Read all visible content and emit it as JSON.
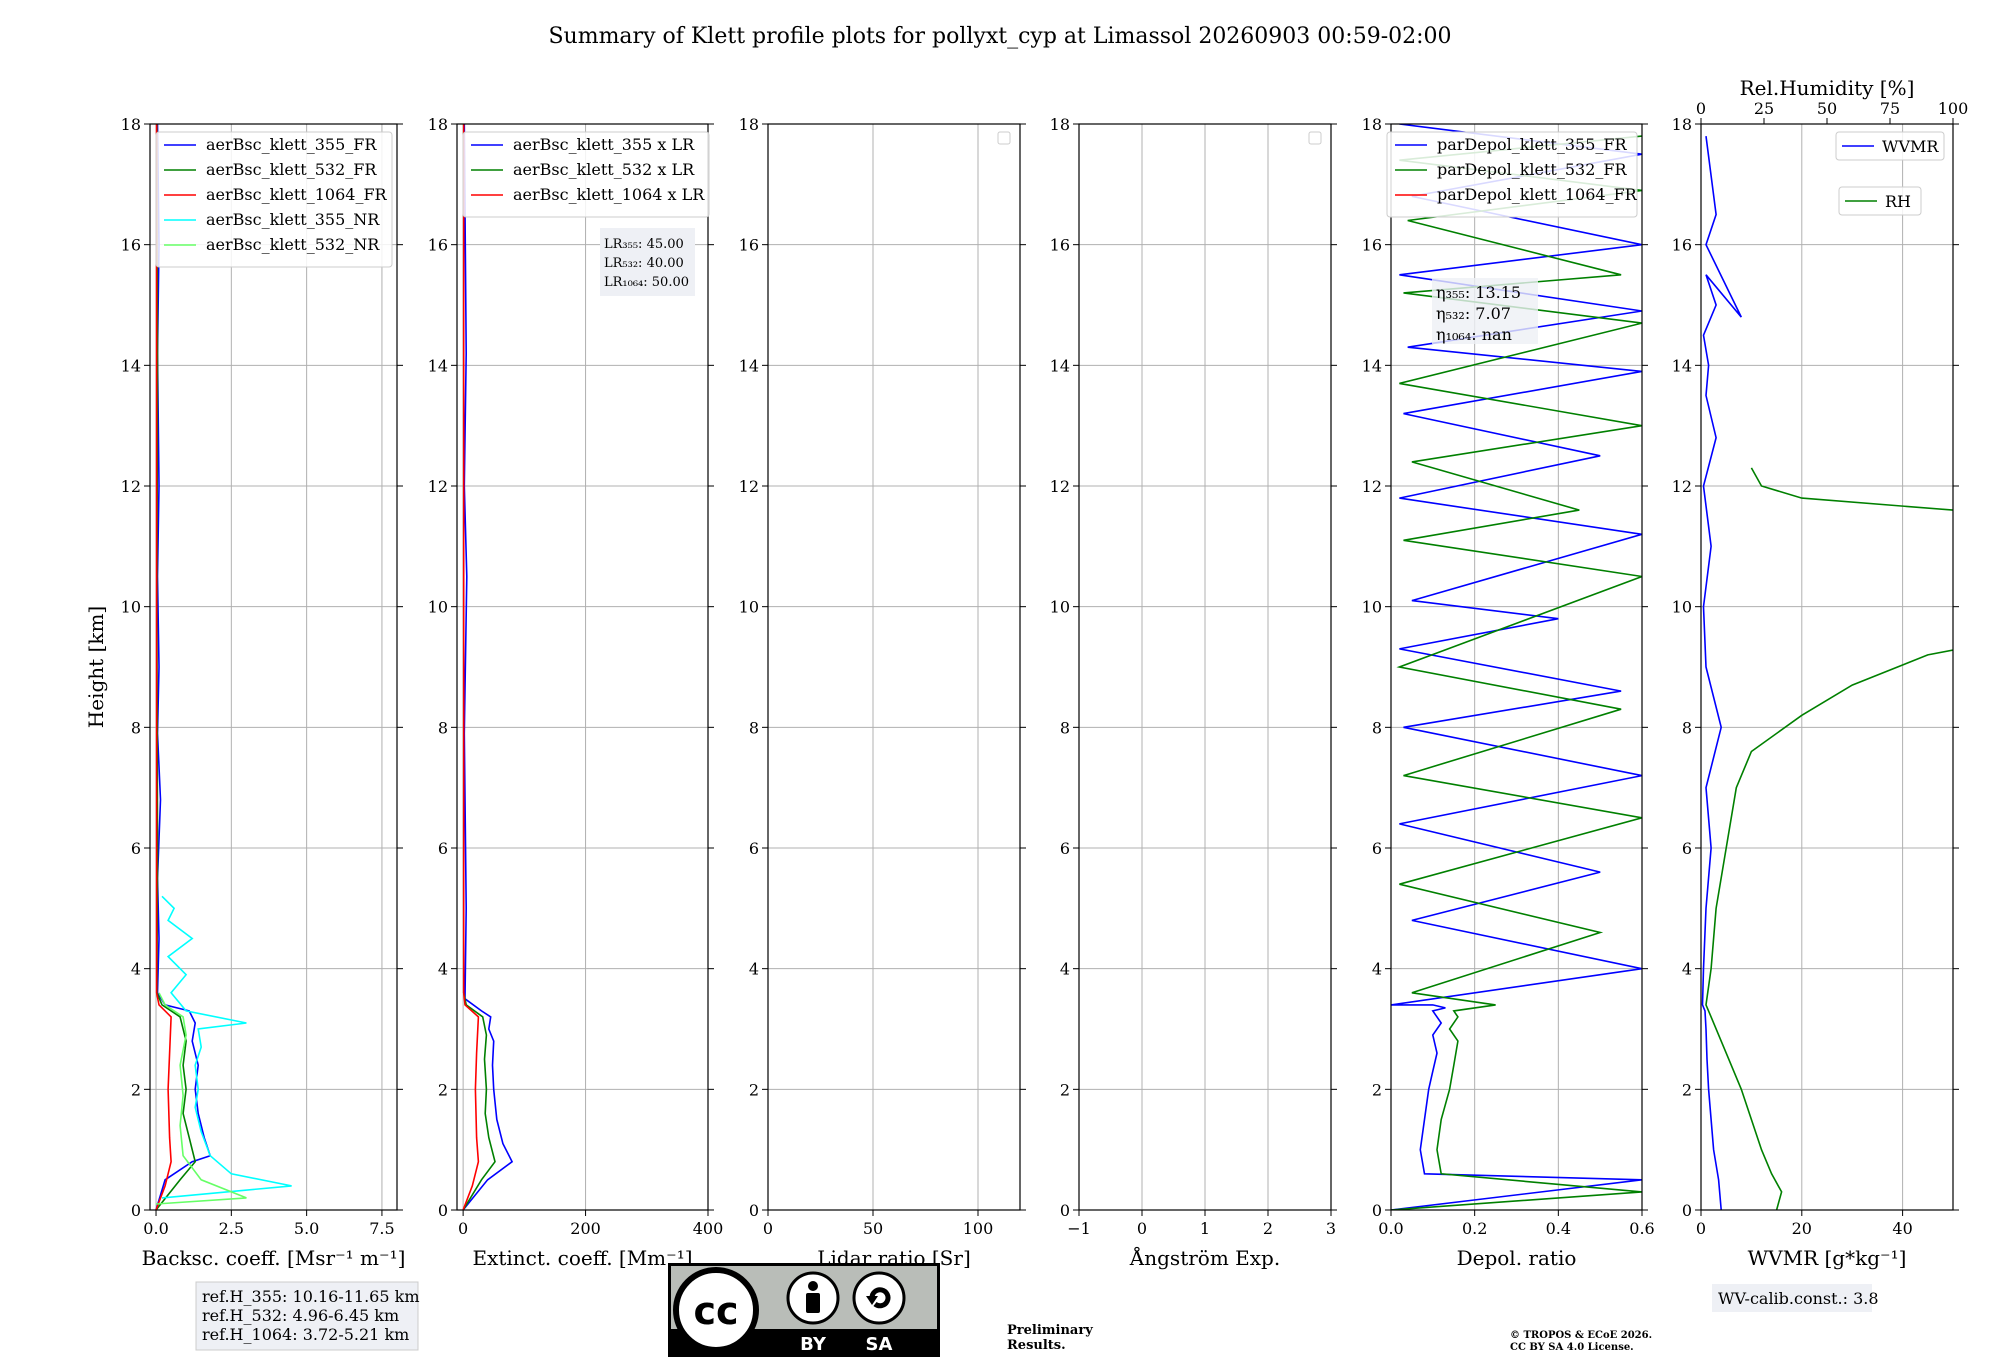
{
  "title": "Summary of Klett profile plots for pollyxt_cyp at Limassol 20260903 00:59-02:00",
  "chart_data": [
    {
      "type": "line",
      "id": "bsc",
      "xlabel": "Backsc. coeff. [Msr⁻¹ m⁻¹]",
      "ylabel": "Height [km]",
      "xlim": [
        -0.2,
        8.0
      ],
      "ylim": [
        0,
        18
      ],
      "xticks": [
        "0.0",
        "2.5",
        "5.0",
        "7.5"
      ],
      "xtick_values": [
        0,
        2.5,
        5.0,
        7.5
      ],
      "grid": true,
      "legend_position": "top-right",
      "series": [
        {
          "name": "aerBsc_klett_355_FR",
          "color": "#0000ff",
          "x": [
            0.0,
            0.3,
            1.2,
            1.8,
            1.6,
            1.4,
            1.3,
            1.4,
            1.2,
            1.3,
            1.1,
            0.3,
            0.05,
            0.1,
            0.05,
            0.15,
            0.05,
            0.1,
            0.05,
            0.1,
            0.05,
            0.1,
            0.05
          ],
          "y": [
            0.0,
            0.5,
            0.8,
            0.9,
            1.2,
            1.6,
            2.0,
            2.4,
            2.8,
            3.1,
            3.3,
            3.4,
            3.6,
            4.5,
            5.5,
            6.8,
            7.9,
            9.0,
            10.5,
            12.0,
            14.2,
            16.0,
            18.0
          ]
        },
        {
          "name": "aerBsc_klett_532_FR",
          "color": "#008000",
          "x": [
            0.0,
            0.8,
            1.3,
            1.1,
            0.9,
            1.0,
            0.9,
            1.0,
            0.8,
            0.2,
            0.03,
            0.05,
            0.03,
            0.05,
            0.03
          ],
          "y": [
            0.0,
            0.5,
            0.8,
            1.2,
            1.6,
            2.0,
            2.4,
            2.8,
            3.2,
            3.4,
            3.6,
            6.0,
            10.0,
            14.0,
            18.0
          ]
        },
        {
          "name": "aerBsc_klett_1064_FR",
          "color": "#ff0000",
          "x": [
            0.0,
            0.3,
            0.5,
            0.45,
            0.4,
            0.45,
            0.5,
            0.1,
            0.02,
            0.02,
            0.02
          ],
          "y": [
            0.0,
            0.4,
            0.8,
            1.2,
            2.0,
            2.6,
            3.2,
            3.4,
            3.6,
            10.0,
            18.0
          ]
        },
        {
          "name": "aerBsc_klett_355_NR",
          "color": "#00ffff",
          "x": [
            0.2,
            4.5,
            2.5,
            1.8,
            1.5,
            1.3,
            1.4,
            1.3,
            1.5,
            1.4,
            3.0,
            1.0,
            0.5,
            1.0,
            0.4,
            1.2,
            0.4,
            0.6,
            0.2
          ],
          "y": [
            0.2,
            0.4,
            0.6,
            0.9,
            1.3,
            1.7,
            2.0,
            2.4,
            2.7,
            3.0,
            3.1,
            3.3,
            3.6,
            3.9,
            4.2,
            4.5,
            4.8,
            5.0,
            5.2
          ]
        },
        {
          "name": "aerBsc_klett_532_NR",
          "color": "#66ff66",
          "x": [
            0.0,
            3.0,
            1.5,
            0.9,
            0.8,
            0.9,
            0.8,
            1.0,
            0.9,
            0.3,
            0.1
          ],
          "y": [
            0.1,
            0.2,
            0.5,
            0.9,
            1.4,
            1.9,
            2.4,
            2.9,
            3.2,
            3.4,
            3.6
          ]
        }
      ]
    },
    {
      "type": "line",
      "id": "ext",
      "xlabel": "Extinct. coeff. [Mm⁻¹]",
      "xlim": [
        -10,
        400
      ],
      "ylim": [
        0,
        18
      ],
      "xticks": [
        "0",
        "200",
        "400"
      ],
      "xtick_values": [
        0,
        200,
        400
      ],
      "grid": true,
      "legend_position": "top-right",
      "annotation": [
        "LR₃₅₅: 45.00",
        "LR₅₃₂: 40.00",
        "LR₁₀₆₄: 50.00"
      ],
      "series": [
        {
          "name": "aerBsc_klett_355 x LR",
          "color": "#0000ff",
          "x": [
            0,
            40,
            80,
            65,
            55,
            50,
            48,
            50,
            42,
            45,
            30,
            3,
            5,
            2,
            6,
            2,
            5,
            2
          ],
          "y": [
            0.0,
            0.5,
            0.8,
            1.1,
            1.5,
            2.0,
            2.4,
            2.8,
            3.0,
            3.2,
            3.3,
            3.5,
            5.0,
            7.9,
            10.5,
            12.0,
            14.2,
            18.0
          ]
        },
        {
          "name": "aerBsc_klett_532 x LR",
          "color": "#008000",
          "x": [
            0,
            30,
            52,
            42,
            36,
            38,
            35,
            38,
            32,
            5,
            1,
            1
          ],
          "y": [
            0.0,
            0.5,
            0.8,
            1.2,
            1.6,
            2.0,
            2.5,
            2.9,
            3.2,
            3.4,
            3.6,
            18.0
          ]
        },
        {
          "name": "aerBsc_klett_1064 x LR",
          "color": "#ff0000",
          "x": [
            0,
            15,
            25,
            22,
            20,
            22,
            25,
            3,
            1,
            1
          ],
          "y": [
            0.0,
            0.4,
            0.8,
            1.2,
            2.0,
            2.6,
            3.2,
            3.4,
            3.6,
            18.0
          ]
        }
      ]
    },
    {
      "type": "line",
      "id": "lr",
      "xlabel": "Lidar ratio [Sr]",
      "xlim": [
        0,
        120
      ],
      "ylim": [
        0,
        18
      ],
      "xticks": [
        "0",
        "50",
        "100"
      ],
      "xtick_values": [
        0,
        50,
        100
      ],
      "grid": true,
      "series": []
    },
    {
      "type": "line",
      "id": "ae",
      "xlabel": "Ångström Exp.",
      "xlim": [
        -1,
        3
      ],
      "ylim": [
        0,
        18
      ],
      "xticks": [
        "−1",
        "0",
        "1",
        "2",
        "3"
      ],
      "xtick_values": [
        -1,
        0,
        1,
        2,
        3
      ],
      "grid": true,
      "series": []
    },
    {
      "type": "line",
      "id": "depol",
      "xlabel": "Depol. ratio",
      "xlim": [
        0,
        0.6
      ],
      "ylim": [
        0,
        18
      ],
      "xticks": [
        "0.0",
        "0.2",
        "0.4",
        "0.6"
      ],
      "xtick_values": [
        0,
        0.2,
        0.4,
        0.6
      ],
      "grid": true,
      "legend_position": "top-right",
      "annotation": [
        "η₃₅₅: 13.15",
        "η₅₃₂: 7.07",
        "η₁₀₆₄: nan"
      ],
      "series": [
        {
          "name": "parDepol_klett_355_FR",
          "color": "#0000ff",
          "x": [
            0.0,
            0.6,
            0.08,
            0.07,
            0.08,
            0.09,
            0.1,
            0.11,
            0.1,
            0.12,
            0.1,
            0.13,
            0.1,
            0.0,
            0.6,
            0.05,
            0.5,
            0.02,
            0.6,
            0.03,
            0.55,
            0.02,
            0.4,
            0.05,
            0.6,
            0.02,
            0.5,
            0.03,
            0.6,
            0.04,
            0.6,
            0.02,
            0.6,
            0.05,
            0.6,
            0.02
          ],
          "y": [
            0.0,
            0.5,
            0.6,
            1.0,
            1.5,
            2.0,
            2.3,
            2.6,
            2.9,
            3.1,
            3.3,
            3.35,
            3.4,
            3.4,
            4.0,
            4.8,
            5.6,
            6.4,
            7.2,
            8.0,
            8.6,
            9.3,
            9.8,
            10.1,
            11.2,
            11.8,
            12.5,
            13.2,
            13.9,
            14.3,
            14.9,
            15.5,
            16.0,
            16.8,
            17.5,
            18.0
          ]
        },
        {
          "name": "parDepol_klett_532_FR",
          "color": "#008000",
          "x": [
            0.0,
            0.6,
            0.12,
            0.11,
            0.12,
            0.14,
            0.15,
            0.16,
            0.14,
            0.16,
            0.15,
            0.25,
            0.05,
            0.5,
            0.02,
            0.6,
            0.03,
            0.55,
            0.02,
            0.6,
            0.03,
            0.45,
            0.05,
            0.6,
            0.02,
            0.6,
            0.03,
            0.55,
            0.04,
            0.6,
            0.02,
            0.6
          ],
          "y": [
            0.0,
            0.3,
            0.6,
            1.0,
            1.5,
            2.0,
            2.4,
            2.8,
            3.0,
            3.2,
            3.3,
            3.4,
            3.6,
            4.6,
            5.4,
            6.5,
            7.2,
            8.3,
            9.0,
            10.5,
            11.1,
            11.6,
            12.4,
            13.0,
            13.7,
            14.7,
            15.2,
            15.5,
            16.4,
            16.9,
            17.4,
            17.8
          ]
        }
      ],
      "series_legend_only": [
        {
          "name": "parDepol_klett_1064_FR",
          "color": "#ff0000"
        }
      ]
    },
    {
      "type": "line",
      "id": "wv",
      "xlabel": "WVMR [g*kg⁻¹]",
      "top_xlabel": "Rel.Humidity [%]",
      "xlim": [
        0,
        50
      ],
      "ylim": [
        0,
        18
      ],
      "xticks": [
        "0",
        "20",
        "40"
      ],
      "xtick_values": [
        0,
        20,
        40
      ],
      "top_xlim": [
        0,
        100
      ],
      "top_xticks": [
        "0",
        "25",
        "50",
        "75",
        "100"
      ],
      "top_xtick_values": [
        0,
        25,
        50,
        75,
        100
      ],
      "grid": true,
      "legend_position": "top-right",
      "annotation": [
        "WV-calib.const.: 3.8"
      ],
      "series": [
        {
          "name": "WVMR",
          "color": "#0000ff",
          "x": [
            4.0,
            3.5,
            2.5,
            2.0,
            1.5,
            1.2,
            1.0,
            0.8,
            0.3,
            0.5,
            1.0,
            2.0,
            1.0,
            4.0,
            1.0,
            0.5,
            2.0,
            0.5,
            3.0,
            1.0,
            1.5,
            0.5,
            3.0,
            1.0,
            8.0,
            1.0,
            3.0,
            1.0
          ],
          "y": [
            0.0,
            0.5,
            1.0,
            1.5,
            2.0,
            2.5,
            3.0,
            3.3,
            3.4,
            4.0,
            5.0,
            6.0,
            7.0,
            8.0,
            9.0,
            10.0,
            11.0,
            12.0,
            12.8,
            13.5,
            14.0,
            14.5,
            15.0,
            15.5,
            14.8,
            16.0,
            16.5,
            17.8
          ]
        },
        {
          "name": "RH",
          "color": "#008000",
          "x": [
            15,
            16,
            14,
            12,
            10,
            8,
            5,
            2,
            1,
            2,
            3,
            5,
            7,
            10,
            20,
            30,
            45,
            70,
            90,
            100,
            95,
            60,
            80,
            50,
            20,
            12,
            10
          ],
          "y": [
            0.0,
            0.3,
            0.6,
            1.0,
            1.5,
            2.0,
            2.6,
            3.2,
            3.4,
            4.0,
            5.0,
            6.0,
            7.0,
            7.6,
            8.2,
            8.7,
            9.2,
            9.6,
            10.0,
            10.5,
            10.8,
            11.0,
            11.3,
            11.6,
            11.8,
            12.0,
            12.3
          ]
        }
      ]
    }
  ],
  "footer": {
    "ref_lines": [
      "ref.H_355: 10.16-11.65 km",
      "ref.H_532: 4.96-6.45 km",
      "ref.H_1064: 3.72-5.21 km"
    ],
    "preliminary": [
      "Preliminary",
      "Results."
    ],
    "copyright": [
      "© TROPOS & ECoE 2026.",
      "CC BY SA 4.0 License."
    ],
    "license_badge": {
      "by": "BY",
      "sa": "SA",
      "icon": "creative-commons-cc-icon"
    }
  }
}
